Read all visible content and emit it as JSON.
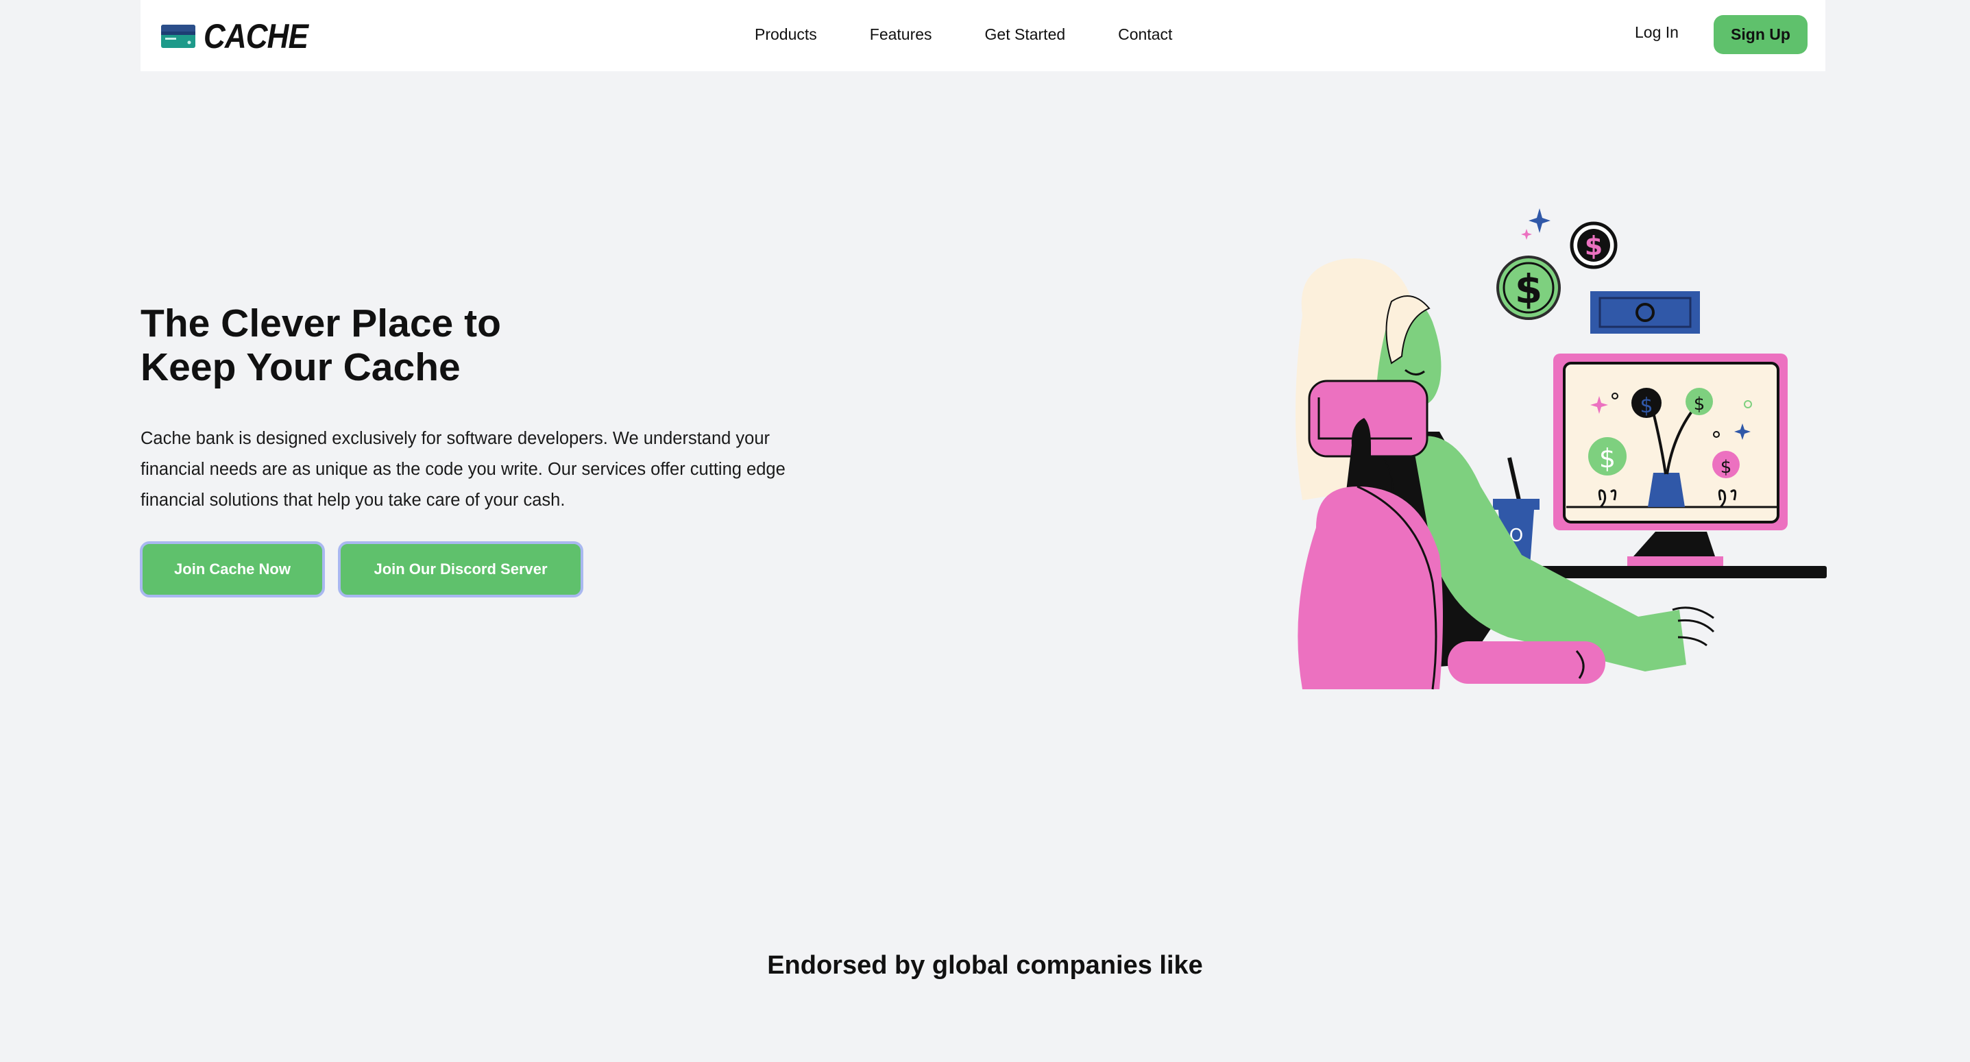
{
  "brand": {
    "name": "CACHE",
    "icon": "credit-card-icon"
  },
  "nav": {
    "links": [
      "Products",
      "Features",
      "Get Started",
      "Contact"
    ]
  },
  "auth": {
    "login_label": "Log In",
    "signup_label": "Sign Up"
  },
  "hero": {
    "title_line1": "The Clever Place to",
    "title_line2": "Keep Your Cache",
    "description": "Cache bank is designed exclusively for software developers. We understand your financial needs are as unique as the code you write. Our services offer cutting edge financial solutions that help you take care of your cash.",
    "cta_primary": "Join Cache Now",
    "cta_secondary": "Join Our Discord Server",
    "illustration": "woman-at-computer-illustration"
  },
  "endorsed": {
    "heading": "Endorsed by global companies like"
  },
  "colors": {
    "accent_green": "#5fc16c",
    "button_outline": "#a9b8f0",
    "pink": "#ec71c0",
    "blue": "#3058a8",
    "background": "#f2f3f5"
  }
}
